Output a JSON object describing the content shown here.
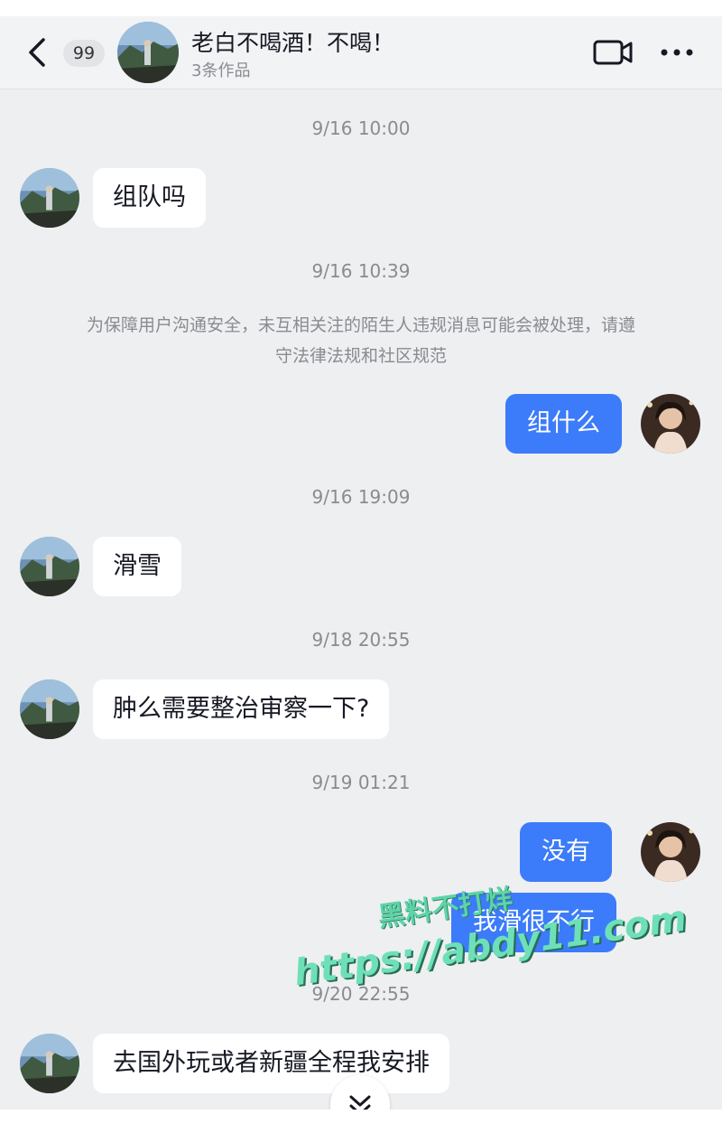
{
  "header": {
    "unread_count": "99",
    "title": "老白不喝酒！不喝！",
    "subtitle": "3条作品",
    "icons": {
      "back": "chevron-left-icon",
      "video": "video-call-icon",
      "more": "more-icon"
    }
  },
  "messages": {
    "ts1": "9/16 10:00",
    "m1": "组队吗",
    "ts2": "9/16 10:39",
    "notice": "为保障用户沟通安全，未互相关注的陌生人违规消息可能会被处理，请遵守法律法规和社区规范",
    "m2": "组什么",
    "ts3": "9/16 19:09",
    "m3": "滑雪",
    "ts4": "9/18 20:55",
    "m4": "肿么需要整治审察一下?",
    "ts5": "9/19 01:21",
    "m5": "没有",
    "m6": "我滑很不行",
    "ts6": "9/20 22:55",
    "m7": "去国外玩或者新疆全程我安排"
  },
  "watermark": {
    "line1": "黑料不打烊",
    "line2": "https://abdy11.com"
  },
  "colors": {
    "outgoing_bubble": "#3c7bfa",
    "incoming_bubble": "#ffffff",
    "background": "#eeeff1"
  }
}
